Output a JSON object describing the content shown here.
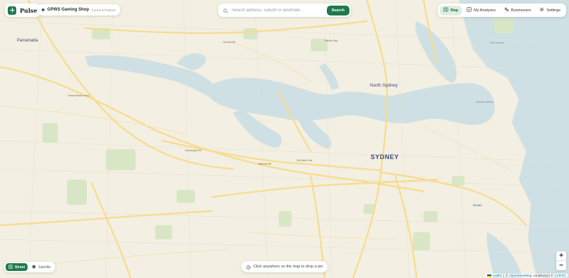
{
  "app": {
    "name": "Pulse"
  },
  "business": {
    "name": "GPWS Gaming Shop",
    "location": "Forest & Pasture"
  },
  "search": {
    "placeholder": "Search address, suburb or landmark…",
    "button_label": "Search"
  },
  "nav": {
    "items": [
      {
        "label": "Map",
        "icon": "map-icon",
        "active": true
      },
      {
        "label": "My Analyses",
        "icon": "checklist-icon",
        "active": false
      },
      {
        "label": "Businesses",
        "icon": "businesses-icon",
        "active": false
      },
      {
        "label": "Settings",
        "icon": "gear-icon",
        "active": false
      }
    ]
  },
  "map": {
    "places": {
      "parramatta": "Parramatta",
      "north_sydney": "North Sydney",
      "sydney": "SYDNEY",
      "bondi": "BONDI",
      "port_jackson": "Port Jackson",
      "sydney_harbour": "Sydney Harbour",
      "balmain_rd": "Balmain Rd",
      "victoria_rd": "Victoria Rd",
      "city_west_link": "City West Link",
      "parramatta_rd": "Parramatta Rd",
      "great_western_hwy": "Great Western Hwy",
      "pacific_hwy": "Pacific Hwy"
    },
    "layers": {
      "street_label": "Street",
      "satellite_label": "Satellite",
      "active": "street"
    },
    "hint": "Click anywhere on the map to drop a pin",
    "zoom": {
      "in": "+",
      "out": "−"
    },
    "attribution": {
      "leaflet": "Leaflet",
      "sep1": "|",
      "copyright": "©",
      "osm": "OpenStreetMap",
      "contributors": "contributors ©",
      "carto": "CARTO"
    }
  },
  "colors": {
    "accent": "#1f7a4d",
    "water": "#cfe0e4",
    "land": "#f3efe2",
    "park": "#d8e6c5",
    "road": "#f7dc8c"
  }
}
